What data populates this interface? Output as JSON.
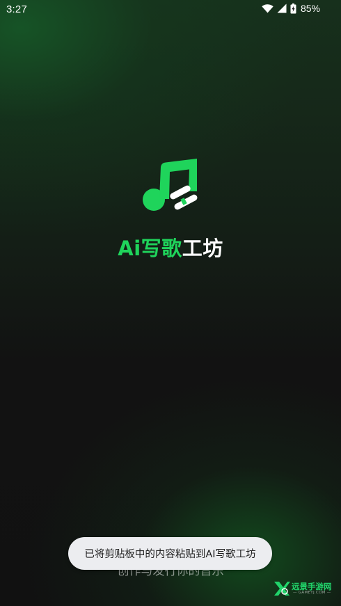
{
  "status_bar": {
    "time": "3:27",
    "battery": "85%",
    "icons": [
      "wifi-icon",
      "cell-signal-icon",
      "battery-charging-icon"
    ]
  },
  "splash": {
    "title_green": "Ai写歌",
    "title_white": "工坊",
    "slogan": "创作与发行你的音乐",
    "logo_icon": "music-note-icon",
    "accent_color": "#1fd45b"
  },
  "toast": {
    "message": "已将剪贴板中的内容粘贴到AI写歌工坊"
  },
  "watermark": {
    "text": "远景手游网",
    "sub": "— GAMEYJ.COM —"
  }
}
